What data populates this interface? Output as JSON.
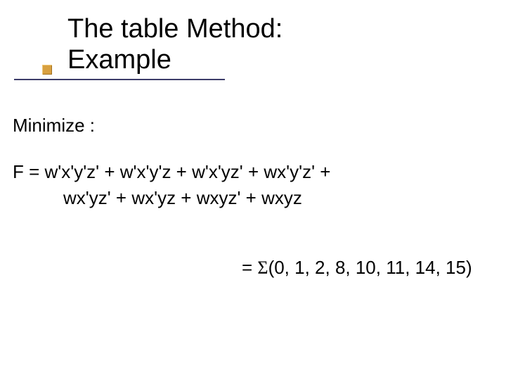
{
  "title": {
    "line1": "The table Method:",
    "line2": "Example"
  },
  "body": {
    "minimize_label": "Minimize :",
    "expr_line1": "F = w'x'y'z' + w'x'y'z + w'x'yz' + wx'y'z' +",
    "expr_line2": "wx'yz' + wx'yz + wxyz' + wxyz",
    "sigma_prefix": "= ",
    "sigma_symbol": "Σ",
    "sigma_list": "(0, 1, 2, 8, 10, 11, 14, 15)"
  }
}
